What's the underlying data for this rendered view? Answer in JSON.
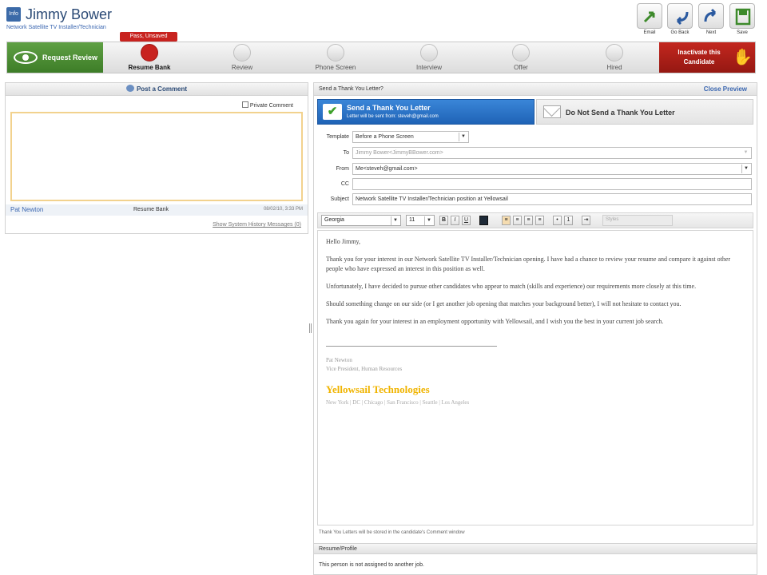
{
  "header": {
    "logo_text": "Info",
    "candidate_name": "Jimmy Bower",
    "job_title": "Network Satellite TV Installer/Technician",
    "toolbar": [
      {
        "label": "Email",
        "icon": "email-icon"
      },
      {
        "label": "Go Back",
        "icon": "go-back-icon"
      },
      {
        "label": "Next",
        "icon": "next-icon"
      },
      {
        "label": "Save",
        "icon": "save-icon"
      }
    ]
  },
  "workflow": {
    "request_review": "Request Review",
    "inactivate": "Inactivate this Candidate",
    "status_badge": "Pass, Unsaved",
    "stages": [
      {
        "label": "Resume Bank",
        "active": true
      },
      {
        "label": "Review",
        "active": false
      },
      {
        "label": "Phone Screen",
        "active": false
      },
      {
        "label": "Interview",
        "active": false
      },
      {
        "label": "Offer",
        "active": false
      },
      {
        "label": "Hired",
        "active": false
      }
    ],
    "colors": {
      "green": "#4a8a32",
      "red": "#b01f19",
      "active_stage": "#c8231f"
    }
  },
  "comments": {
    "header": "Post a Comment",
    "private_label": "Private Comment",
    "entry": {
      "author": "Pat Newton",
      "stage": "Resume Bank",
      "date": "08/02/10, 3:33 PM"
    },
    "history_link": "Show System History Messages (0)"
  },
  "letter": {
    "panel_title": "Send a Thank You Letter?",
    "close_preview": "Close Preview",
    "send_option": {
      "title": "Send a Thank You Letter",
      "subtitle": "Letter will be sent from: steveh@gmail.com"
    },
    "no_send_option": "Do Not Send a Thank You Letter",
    "fields": {
      "template_label": "Template",
      "template_value": "Before a Phone Screen",
      "to_label": "To",
      "to_value": "Jimmy Bower<JimmyBBower.com>",
      "from_label": "From",
      "from_value": "Me<steveh@gmail.com>",
      "cc_label": "CC",
      "cc_value": "",
      "subject_label": "Subject",
      "subject_value": "Network Satellite TV Installer/Technician position at Yellowsail"
    },
    "editor_toolbar": {
      "font": "Georgia",
      "size": "11",
      "bold": "B",
      "italic": "I",
      "underline": "U",
      "style_field": "Styles"
    },
    "body": {
      "greeting": "Hello Jimmy,",
      "p1": "Thank you for your interest in our Network Satellite TV Installer/Technician opening. I have had a chance to review your resume and compare it against other people who have expressed an interest in this position as well.",
      "p2": "Unfortunately, I have decided to pursue other candidates who appear to match (skills and experience) our requirements more closely at this time.",
      "p3": "Should something change on our side (or I get another job opening that matches your background better), I will not hesitate to contact you.",
      "p4": "Thank you again for your interest in an employment opportunity with Yellowsail, and I wish you the best in your current job search.",
      "sig_name": "Pat Newton",
      "sig_title": "Vice President, Human Resources",
      "company": "Yellowsail Technologies",
      "cities": "New York | DC | Chicago | San Francisco | Seattle | Los Angeles"
    },
    "note": "Thank You Letters will be stored in the candidate's Comment window",
    "resume_header": "Resume/Profile",
    "assignment_text": "This person is not assigned to another job."
  }
}
